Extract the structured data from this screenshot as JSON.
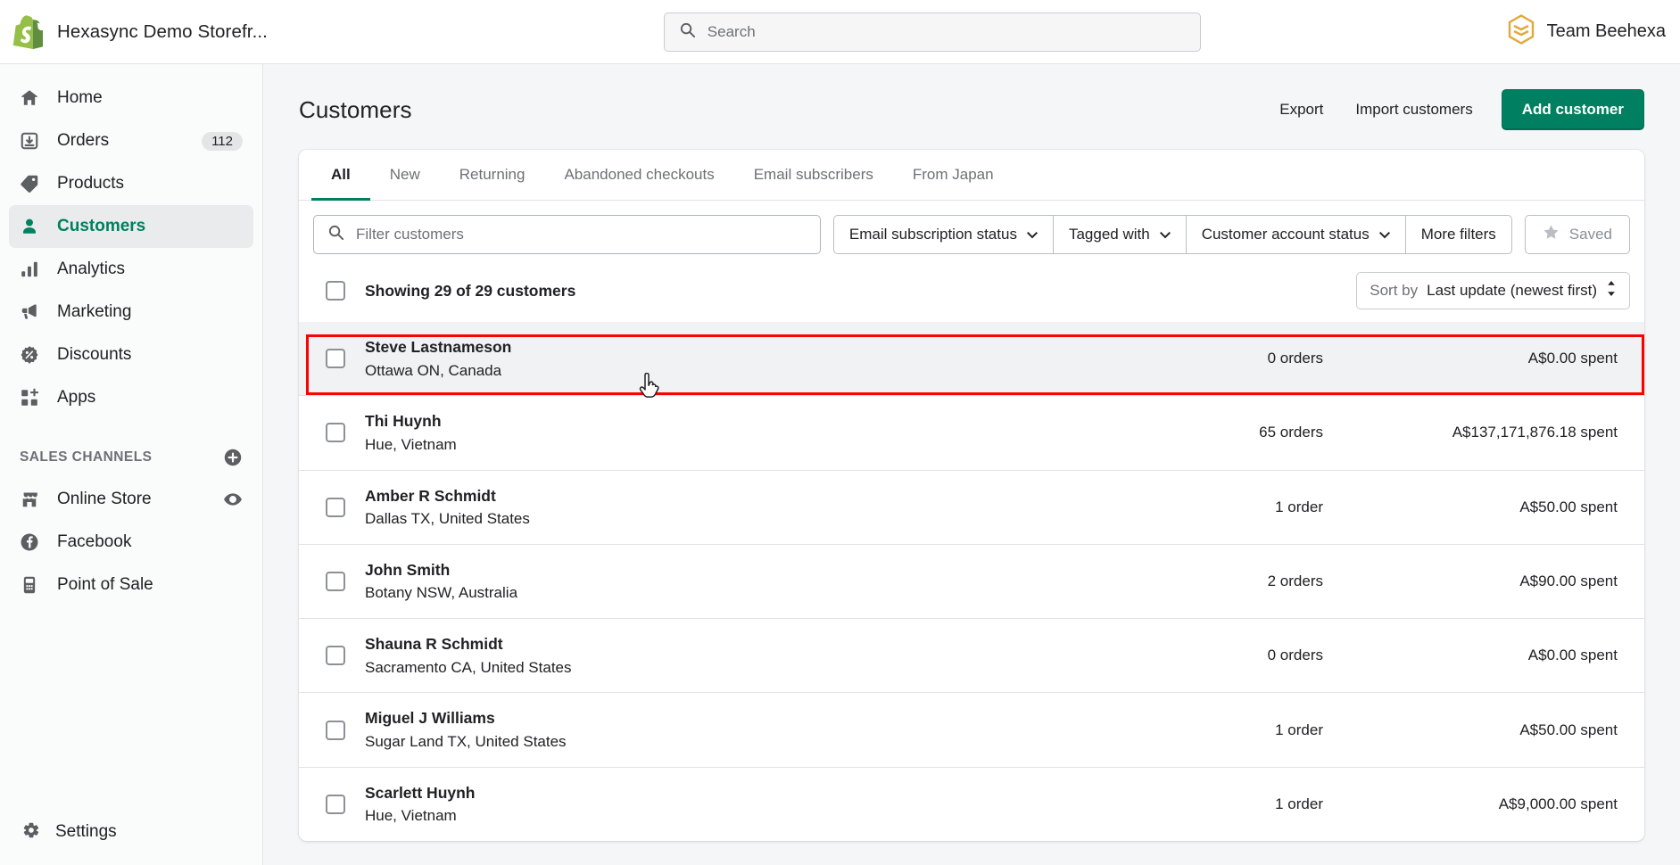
{
  "topbar": {
    "store_name": "Hexasync Demo Storefr...",
    "logo_icon": "shopify-bag-icon",
    "search": {
      "placeholder": "Search",
      "icon": "search-icon"
    },
    "account": {
      "name": "Team Beehexa",
      "avatar_icon": "beehexa-hexagon-icon",
      "accent": "#E0A93B"
    }
  },
  "sidebar": {
    "items": [
      {
        "label": "Home",
        "icon": "home-icon",
        "badge": null,
        "active": false
      },
      {
        "label": "Orders",
        "icon": "orders-inbox-icon",
        "badge": "112",
        "active": false
      },
      {
        "label": "Products",
        "icon": "products-tag-icon",
        "badge": null,
        "active": false
      },
      {
        "label": "Customers",
        "icon": "customers-person-icon",
        "badge": null,
        "active": true
      },
      {
        "label": "Analytics",
        "icon": "analytics-bars-icon",
        "badge": null,
        "active": false
      },
      {
        "label": "Marketing",
        "icon": "marketing-megaphone-icon",
        "badge": null,
        "active": false
      },
      {
        "label": "Discounts",
        "icon": "discounts-percent-icon",
        "badge": null,
        "active": false
      },
      {
        "label": "Apps",
        "icon": "apps-grid-plus-icon",
        "badge": null,
        "active": false
      }
    ],
    "section_title": "SALES CHANNELS",
    "section_add_icon": "plus-circle-icon",
    "channels": [
      {
        "label": "Online Store",
        "icon": "online-store-icon",
        "trailing_icon": "eye-icon"
      },
      {
        "label": "Facebook",
        "icon": "facebook-icon",
        "trailing_icon": null
      },
      {
        "label": "Point of Sale",
        "icon": "point-of-sale-icon",
        "trailing_icon": null
      }
    ],
    "settings": {
      "label": "Settings",
      "icon": "gear-icon"
    },
    "active_accent": "#008060"
  },
  "page": {
    "title": "Customers",
    "actions": {
      "export": "Export",
      "import": "Import customers",
      "add_customer": "Add customer",
      "primary_color": "#008060"
    }
  },
  "tabs": [
    {
      "label": "All",
      "active": true
    },
    {
      "label": "New",
      "active": false
    },
    {
      "label": "Returning",
      "active": false
    },
    {
      "label": "Abandoned checkouts",
      "active": false
    },
    {
      "label": "Email subscribers",
      "active": false
    },
    {
      "label": "From Japan",
      "active": false
    }
  ],
  "filters": {
    "search_placeholder": "Filter customers",
    "search_icon": "search-icon",
    "dropdowns": [
      {
        "label": "Email subscription status",
        "icon": "chevron-down-icon"
      },
      {
        "label": "Tagged with",
        "icon": "chevron-down-icon"
      },
      {
        "label": "Customer account status",
        "icon": "chevron-down-icon"
      }
    ],
    "more_filters": "More filters",
    "saved": {
      "label": "Saved",
      "icon": "star-icon",
      "disabled": true
    }
  },
  "list_header": {
    "showing_text": "Showing 29 of 29 customers",
    "sort_prefix": "Sort by",
    "sort_value": "Last update (newest first)",
    "sort_icon": "sort-updown-icon"
  },
  "customers": [
    {
      "name": "Steve Lastnameson",
      "location": "Ottawa ON, Canada",
      "orders": "0 orders",
      "spent": "A$0.00 spent",
      "highlighted": true
    },
    {
      "name": "Thi Huynh",
      "location": "Hue, Vietnam",
      "orders": "65 orders",
      "spent": "A$137,171,876.18 spent",
      "highlighted": false
    },
    {
      "name": "Amber R Schmidt",
      "location": "Dallas TX, United States",
      "orders": "1 order",
      "spent": "A$50.00 spent",
      "highlighted": false
    },
    {
      "name": "John Smith",
      "location": "Botany NSW, Australia",
      "orders": "2 orders",
      "spent": "A$90.00 spent",
      "highlighted": false
    },
    {
      "name": "Shauna R Schmidt",
      "location": "Sacramento CA, United States",
      "orders": "0 orders",
      "spent": "A$0.00 spent",
      "highlighted": false
    },
    {
      "name": "Miguel J Williams",
      "location": "Sugar Land TX, United States",
      "orders": "1 order",
      "spent": "A$50.00 spent",
      "highlighted": false
    },
    {
      "name": "Scarlett Huynh",
      "location": "Hue, Vietnam",
      "orders": "1 order",
      "spent": "A$9,000.00 spent",
      "highlighted": false
    }
  ],
  "annotation": {
    "highlight_color": "#ff0000",
    "cursor_icon": "hand-pointer-cursor"
  }
}
